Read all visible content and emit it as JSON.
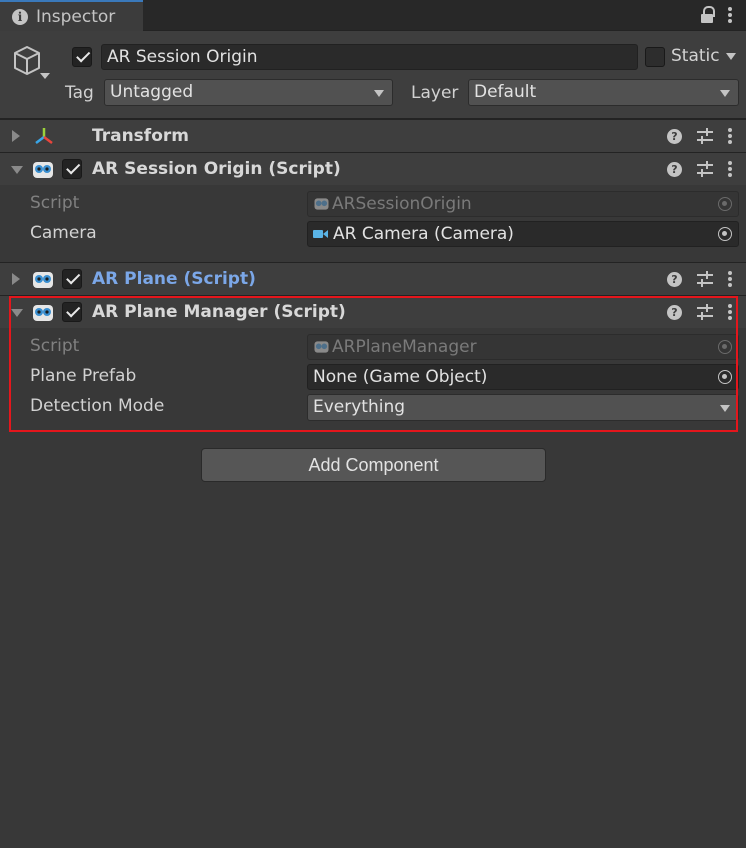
{
  "tab": {
    "title": "Inspector"
  },
  "header": {
    "enabled": true,
    "object_name": "AR Session Origin",
    "static_label": "Static",
    "static_checked": false,
    "tag_label": "Tag",
    "tag_value": "Untagged",
    "layer_label": "Layer",
    "layer_value": "Default"
  },
  "components": [
    {
      "title": "Transform",
      "expanded": false,
      "icon": "transform-gizmo-icon"
    },
    {
      "title": "AR Session Origin (Script)",
      "expanded": true,
      "enabled": true,
      "icon": "script-icon",
      "properties": [
        {
          "label": "Script",
          "value": "ARSessionOrigin",
          "readonly": true
        },
        {
          "label": "Camera",
          "value": "AR Camera (Camera)"
        }
      ]
    },
    {
      "title": "AR Plane (Script)",
      "expanded": false,
      "enabled": true,
      "icon": "script-icon",
      "title_color": "#7ba7e8"
    },
    {
      "title": "AR Plane Manager (Script)",
      "expanded": true,
      "enabled": true,
      "icon": "script-icon",
      "properties": [
        {
          "label": "Script",
          "value": "ARPlaneManager",
          "readonly": true
        },
        {
          "label": "Plane Prefab",
          "value": "None (Game Object)"
        },
        {
          "label": "Detection Mode",
          "value": "Everything"
        }
      ]
    }
  ],
  "add_component_label": "Add Component",
  "colors": {
    "background": "#383838",
    "header": "#3e3e3e",
    "field": "#2a2a2a",
    "highlight": "#e4161c",
    "accent_blue": "#7ba7e8"
  }
}
